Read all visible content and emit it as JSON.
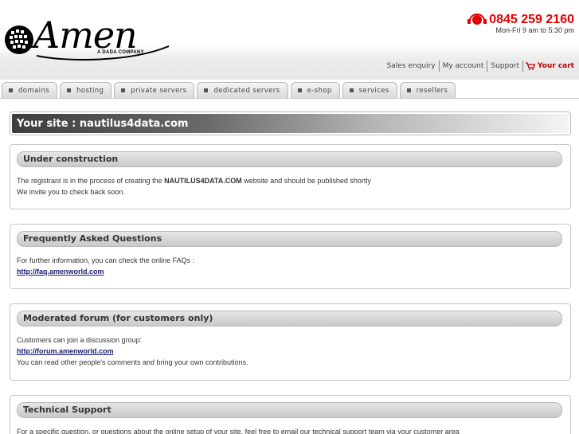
{
  "brand": {
    "logo_word": "Amen",
    "logo_tagline": "A DADA COMPANY"
  },
  "contact": {
    "phone": "0845 259 2160",
    "hours": "Mon-Fri 9 am to 5:30 pm"
  },
  "top_links": {
    "sales": "Sales enquiry",
    "account": "My account",
    "support": "Support",
    "cart": "Your cart"
  },
  "tabs": [
    "domains",
    "hosting",
    "private servers",
    "dedicated servers",
    "e-shop",
    "services",
    "resellers"
  ],
  "site_title": "Your site : nautilus4data.com",
  "sections": {
    "construction": {
      "title": "Under construction",
      "line1_pre": "The registrant is in the process of creating the ",
      "line1_domain": "NAUTILUS4DATA.COM",
      "line1_post": " website and should be published shortly",
      "line2": "We invite you to check back soon."
    },
    "faq": {
      "title": "Frequently Asked Questions",
      "line1": "For further information, you can check the online FAQs :",
      "link": "http://faq.amenworld.com"
    },
    "forum": {
      "title": "Moderated forum (for customers only)",
      "line1": "Customers can join a discussion group:",
      "link": "http://forum.amenworld.com",
      "line2": "You can read other people's comments and bring your own contributions."
    },
    "support": {
      "title": "Technical Support",
      "line1": "For a specific question, or questions about the online setup of your site, feel free to email our technical support team via your customer area"
    }
  },
  "colors": {
    "accent_red": "#e30000",
    "link_blue": "#1a1a6e"
  }
}
